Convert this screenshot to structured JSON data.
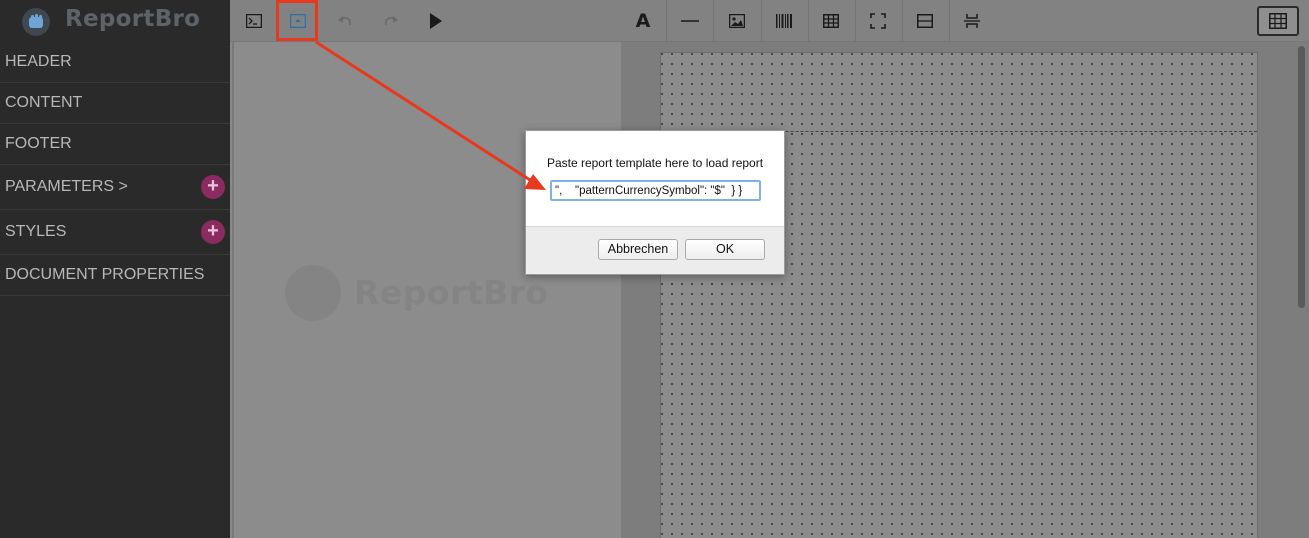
{
  "app": {
    "name": "ReportBro"
  },
  "sidebar": {
    "items": [
      {
        "label": "HEADER",
        "has_add": false
      },
      {
        "label": "CONTENT",
        "has_add": false
      },
      {
        "label": "FOOTER",
        "has_add": false
      },
      {
        "label": "PARAMETERS >",
        "has_add": true,
        "add_label": "+"
      },
      {
        "label": "STYLES",
        "has_add": true,
        "add_label": "+"
      },
      {
        "label": "DOCUMENT PROPERTIES",
        "has_add": false
      }
    ]
  },
  "toolbar": {
    "left_buttons": [
      "terminal-icon",
      "load-report-icon",
      "undo-icon",
      "redo-icon",
      "play-icon"
    ],
    "element_buttons": [
      "text-icon",
      "line-icon",
      "image-icon",
      "barcode-icon",
      "table-icon",
      "frame-icon",
      "section-icon",
      "page-break-icon"
    ],
    "text_button_glyph": "A",
    "grid_toggle": "grid-icon",
    "highlight_color": "#e8391e"
  },
  "canvas": {
    "watermark_text": "ReportBro"
  },
  "dialog": {
    "message": "Paste report template here to load report",
    "input_value": "\",    \"patternCurrencySymbol\": \"$\"  } }",
    "cancel_label": "Abbrechen",
    "ok_label": "OK"
  },
  "colors": {
    "sidebar_bg": "#2a2a2a",
    "accent_plus": "#8c2a62",
    "annotation_red": "#e8391e",
    "input_focus": "#7fb0e8"
  }
}
